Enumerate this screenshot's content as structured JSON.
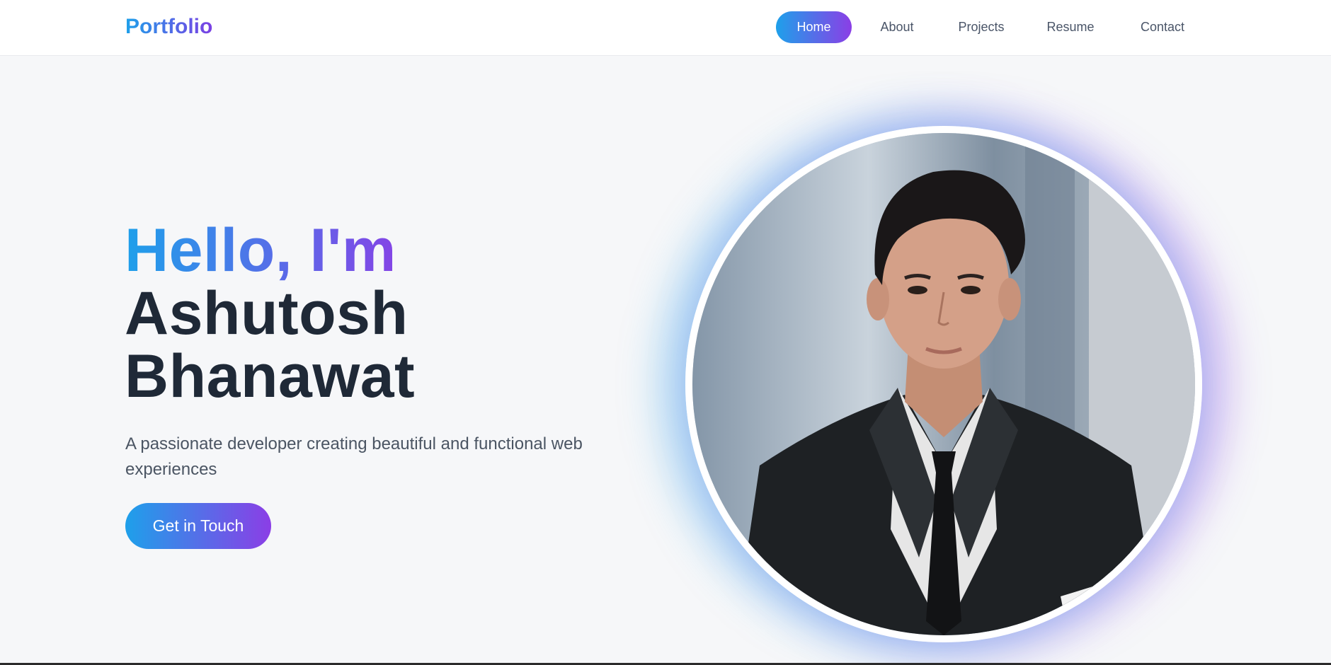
{
  "nav": {
    "brand": "Portfolio",
    "links": [
      {
        "label": "Home",
        "active": true
      },
      {
        "label": "About",
        "active": false
      },
      {
        "label": "Projects",
        "active": false
      },
      {
        "label": "Resume",
        "active": false
      },
      {
        "label": "Contact",
        "active": false
      }
    ]
  },
  "hero": {
    "greeting": "Hello, I'm",
    "first_name": "Ashutosh",
    "last_name": "Bhanawat",
    "tagline": "A passionate developer creating beautiful and functional web experiences",
    "cta_label": "Get in Touch",
    "photo_icon": "profile-photo"
  },
  "colors": {
    "gradient_start": "#1ea0ea",
    "gradient_end": "#8b3ee6",
    "heading": "#1f2937",
    "body_text": "#4b5563",
    "background": "#f6f7f9"
  }
}
